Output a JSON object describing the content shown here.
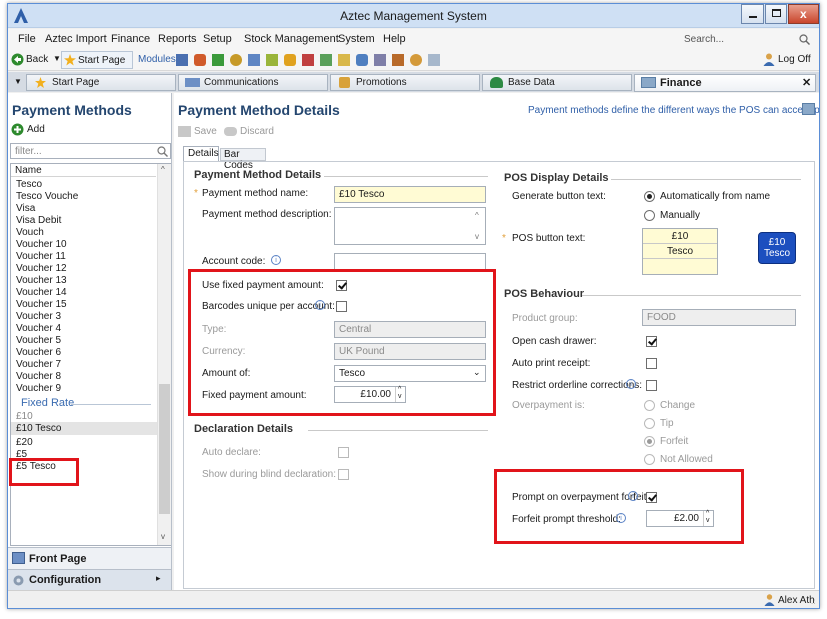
{
  "window": {
    "title": "Aztec Management System"
  },
  "menu": [
    "File",
    "Aztec Import",
    "Finance",
    "Reports",
    "Setup",
    "Stock Management",
    "System",
    "Help"
  ],
  "search": {
    "placeholder": "Search..."
  },
  "toolbar": {
    "back": "Back",
    "start_page": "Start Page",
    "modules": "Modules",
    "logoff": "Log Off"
  },
  "tabs": [
    "Start Page",
    "Communications",
    "Promotions",
    "Base Data",
    "Finance"
  ],
  "sidebar": {
    "title": "Payment Methods",
    "add": "Add",
    "filter_placeholder": "filter...",
    "list_header": "Name",
    "items": [
      "Tesco",
      "Tesco Vouche",
      "Visa",
      "Visa Debit",
      "Vouch",
      "Voucher 10",
      "Voucher 11",
      "Voucher 12",
      "Voucher 13",
      "Voucher 14",
      "Voucher 15",
      "Voucher 3",
      "Voucher 4",
      "Voucher 5",
      "Voucher 6",
      "Voucher 7",
      "Voucher 8",
      "Voucher 9"
    ],
    "group_label": "Fixed Rate",
    "group_items": [
      "£10",
      "£10 Tesco",
      "£20",
      "£5",
      "£5 Tesco"
    ],
    "front_page": "Front Page",
    "configuration": "Configuration"
  },
  "main": {
    "title": "Payment Method Details",
    "description": "Payment methods define the different ways the POS can accept payment",
    "save": "Save",
    "discard": "Discard",
    "subtabs": [
      "Details",
      "Bar Codes"
    ]
  },
  "details": {
    "section": "Payment Method Details",
    "name_label": "Payment method name:",
    "name_value": "£10 Tesco",
    "desc_label": "Payment method description:",
    "desc_value": "",
    "account_label": "Account code:",
    "account_value": "",
    "fixed_label": "Use fixed payment amount:",
    "fixed_checked": true,
    "barcodes_label": "Barcodes unique per account:",
    "barcodes_checked": false,
    "type_label": "Type:",
    "type_value": "Central",
    "currency_label": "Currency:",
    "currency_value": "UK Pound",
    "amount_of_label": "Amount of:",
    "amount_of_value": "Tesco",
    "fixed_amount_label": "Fixed payment amount:",
    "fixed_amount_value": "£10.00"
  },
  "declaration": {
    "section": "Declaration Details",
    "auto_label": "Auto declare:",
    "blind_label": "Show during blind declaration:"
  },
  "pos_display": {
    "section": "POS Display Details",
    "generate_label": "Generate button text:",
    "auto_option": "Automatically from name",
    "manual_option": "Manually",
    "button_text_label": "POS button text:",
    "line1": "£10",
    "line2": "Tesco",
    "line3": "",
    "preview1": "£10",
    "preview2": "Tesco"
  },
  "pos_behaviour": {
    "section": "POS Behaviour",
    "product_group_label": "Product group:",
    "product_group_value": "FOOD",
    "cash_drawer_label": "Open cash drawer:",
    "auto_print_label": "Auto print receipt:",
    "restrict_label": "Restrict orderline corrections:",
    "overpayment_label": "Overpayment is:",
    "options": [
      "Change",
      "Tip",
      "Forfeit",
      "Not Allowed"
    ],
    "prompt_label": "Prompt on overpayment forfeit:",
    "threshold_label": "Forfeit prompt threshold:",
    "threshold_value": "£2.00"
  },
  "status": {
    "user": "Alex Ath"
  },
  "colors": {
    "accent": "#1f4e9a",
    "highlight_red": "#e1141a",
    "heading": "#24466f"
  }
}
